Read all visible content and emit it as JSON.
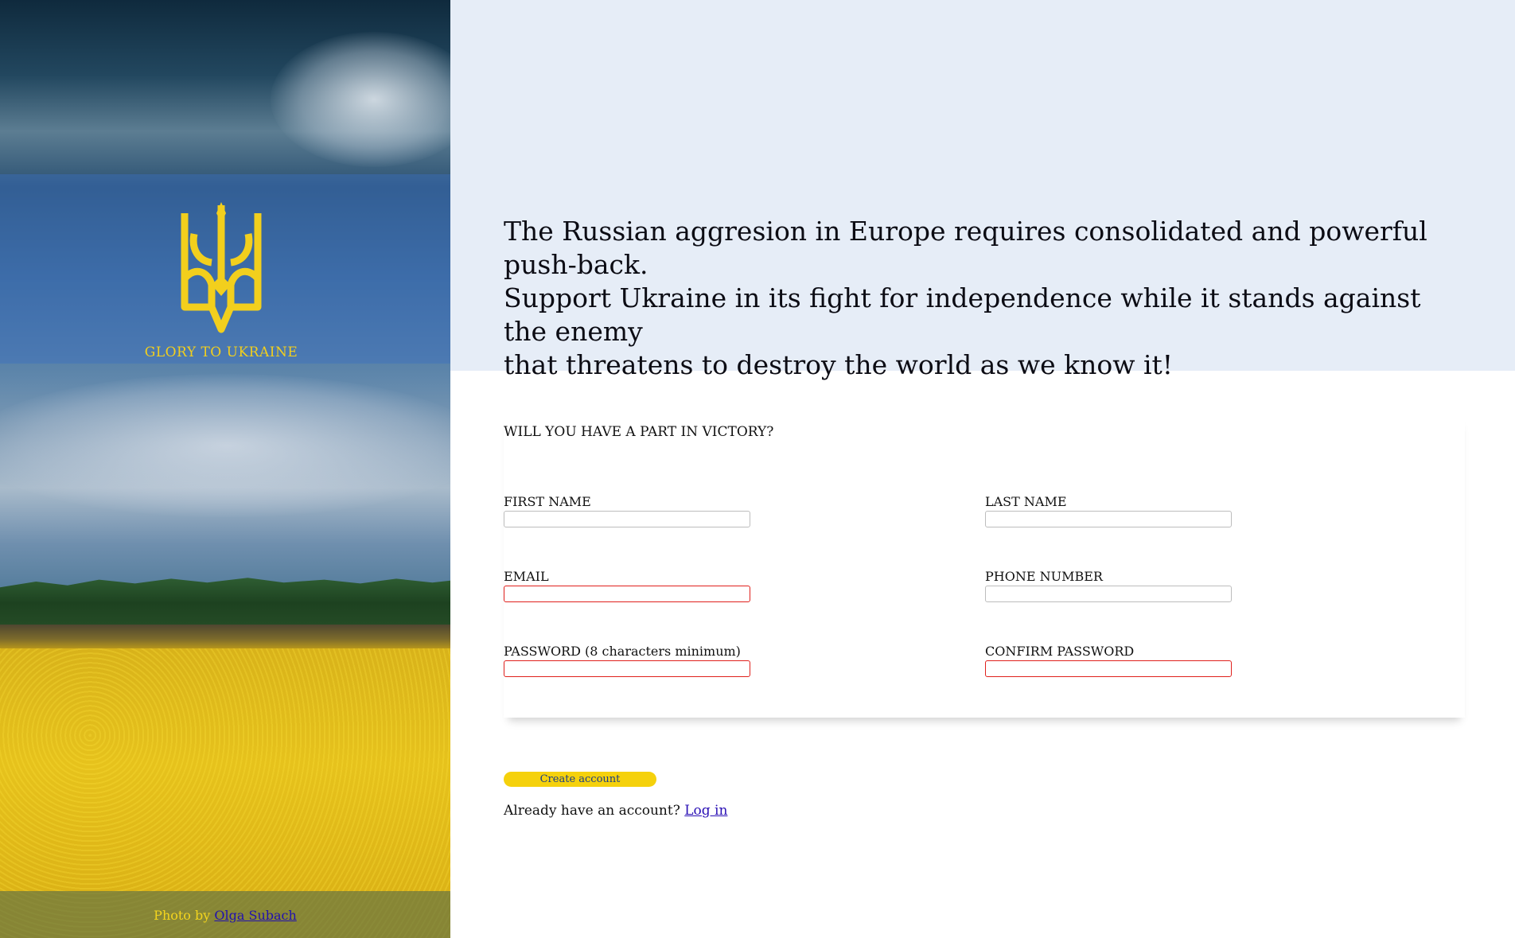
{
  "side": {
    "banner_text": "GLORY TO UKRAINE",
    "photo_credit_prefix": "Photo by",
    "photo_credit_name": "Olga Subach",
    "emblem": "trident-icon",
    "colors": {
      "gold": "#f2cf1d",
      "blue": "#3c6ebe"
    }
  },
  "hero": {
    "line1": "The Russian aggresion in Europe requires consolidated and powerful push-back.",
    "line2": "Support Ukraine in its fight for independence while it stands against the enemy",
    "line3": "that threatens to destroy the world as we know it!"
  },
  "form": {
    "question": "WILL YOU HAVE A PART IN VICTORY?",
    "fields": [
      {
        "label": "FIRST NAME",
        "value": "",
        "invalid": false
      },
      {
        "label": "LAST NAME",
        "value": "",
        "invalid": false
      },
      {
        "label": "EMAIL",
        "value": "",
        "invalid": true
      },
      {
        "label": "PHONE NUMBER",
        "value": "",
        "invalid": false
      },
      {
        "label": "PASSWORD (8 characters minimum)",
        "value": "",
        "invalid": true
      },
      {
        "label": "CONFIRM PASSWORD",
        "value": "",
        "invalid": true
      }
    ],
    "submit_label": "Create account",
    "login_prompt": "Already have an account?",
    "login_link": "Log in",
    "colors": {
      "button": "#f5d10c",
      "invalid_border": "#e0201c"
    }
  }
}
